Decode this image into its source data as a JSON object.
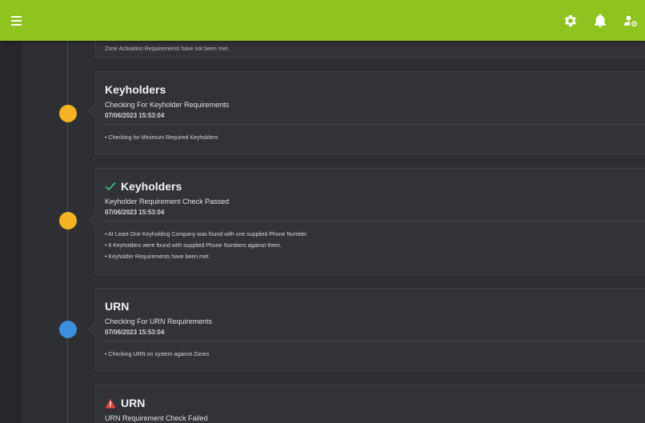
{
  "colors": {
    "topbar": "#8fc31f",
    "dot_amber": "#f5b323",
    "dot_blue": "#3b8fdc",
    "check_green": "#3fbf7f",
    "warn_red": "#e0403c"
  },
  "topbar": {
    "icons": [
      "menu-icon",
      "gear-icon",
      "bell-icon",
      "user-settings-icon"
    ]
  },
  "cut_card": {
    "text": "Zone Activation Requirements have not been met."
  },
  "timeline": [
    {
      "title": "Keyholders",
      "status_icon": "",
      "subtitle": "Checking For Keyholder Requirements",
      "time": "07/06/2023 15:53:04",
      "lines": [
        "• Checking for Minimum Required Keyholders"
      ],
      "dot_color": "#f5b323"
    },
    {
      "title": "Keyholders",
      "status_icon": "check-icon",
      "subtitle": "Keyholder Requirement Check Passed",
      "time": "07/06/2023 15:53:04",
      "lines": [
        "• At Least One Keyholding Company was found with one supplied Phone Number.",
        "• 6 Keyholders were found with supplied Phone Numbers against them.",
        "• Keyholder Requirements have been met."
      ],
      "dot_color": "#f5b323"
    },
    {
      "title": "URN",
      "status_icon": "",
      "subtitle": "Checking For URN Requirements",
      "time": "07/06/2023 15:53:04",
      "lines": [
        "• Checking URN on system against Zones"
      ],
      "dot_color": "#3b8fdc"
    },
    {
      "title": "URN",
      "status_icon": "warning-icon",
      "subtitle": "URN Requirement Check Failed",
      "time": "",
      "lines": [],
      "dot_color": ""
    }
  ]
}
